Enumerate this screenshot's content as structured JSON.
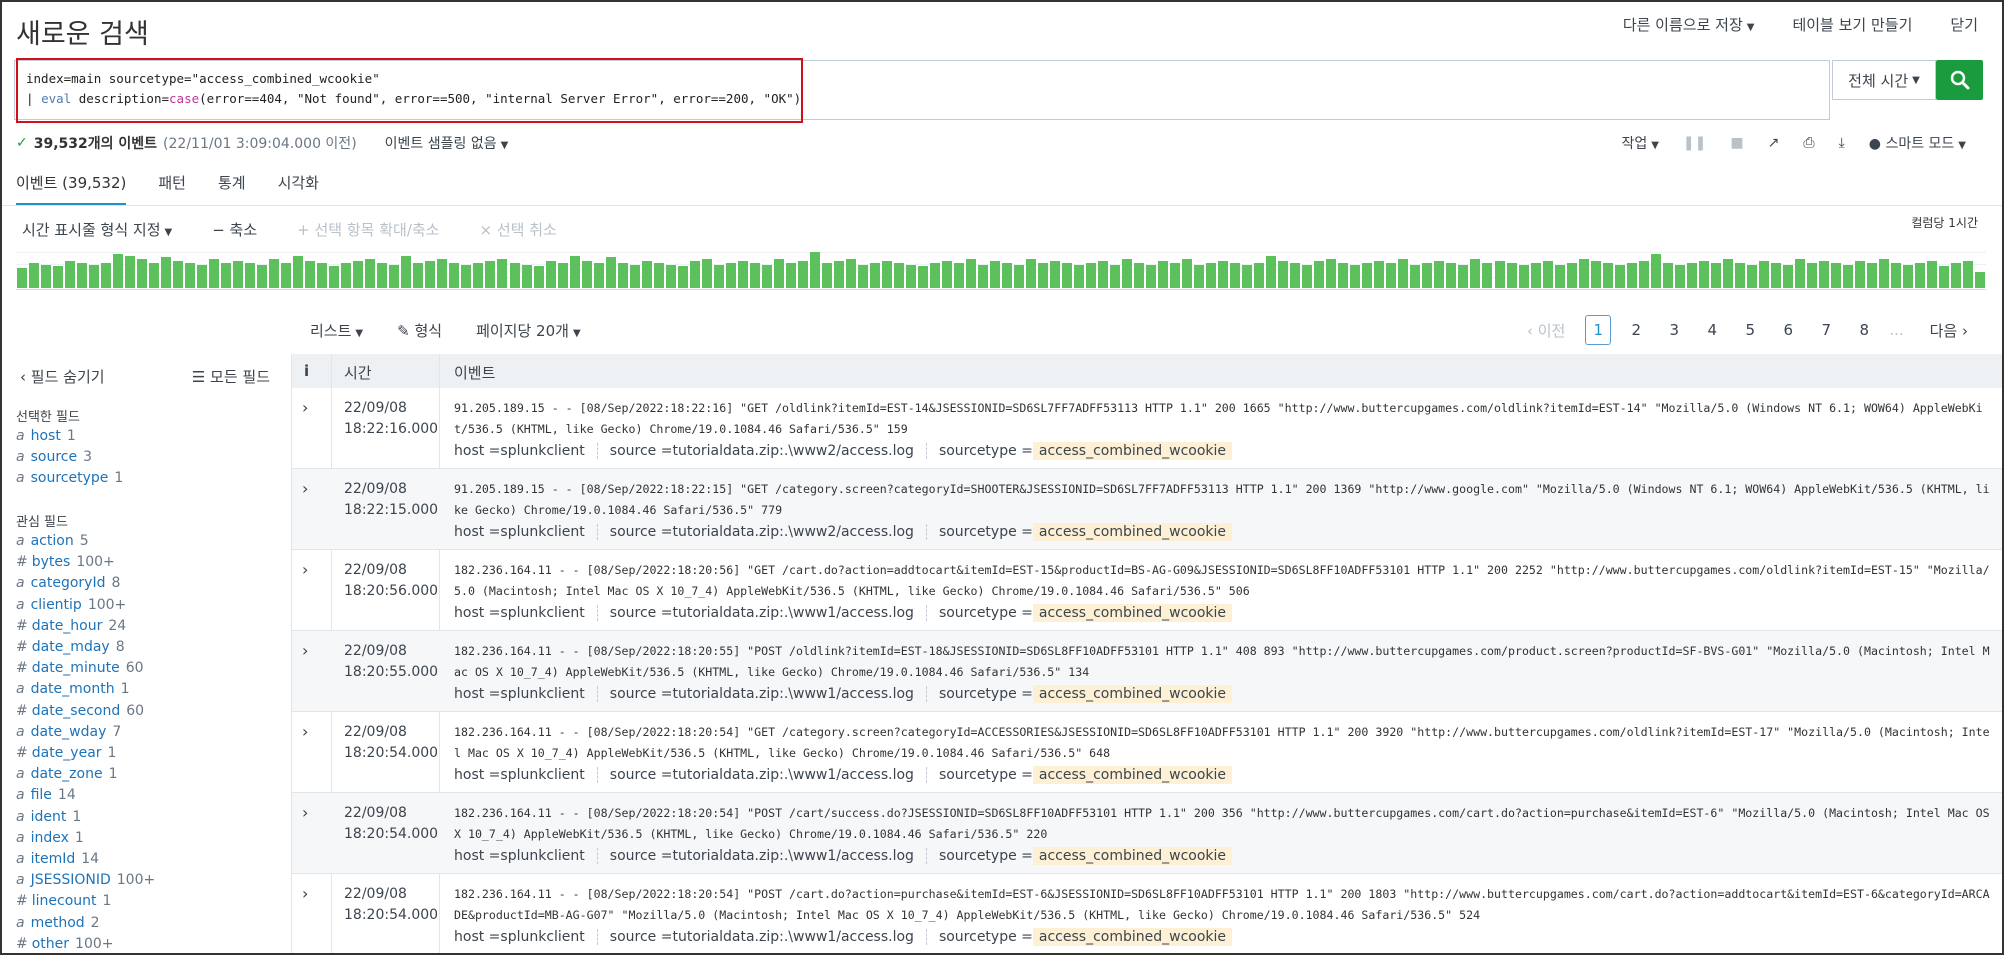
{
  "header": {
    "title": "새로운 검색",
    "save_as": "다른 이름으로 저장",
    "create_table_view": "테이블 보기 만들기",
    "close": "닫기"
  },
  "search": {
    "line1_a": "index=main sourcetype=",
    "line1_b": "\"access_combined_wcookie\"",
    "line2_pipe": "| ",
    "line2_cmd": "eval",
    "line2_mid": " description=",
    "line2_fn": "case",
    "line2_args": "(error==404, \"Not found\", error==500, \"internal Server Error\", error==200, \"OK\")",
    "time_range": "전체 시간"
  },
  "status": {
    "count": "39,532개의 이벤트",
    "before": "(22/11/01 3:09:04.000 이전)",
    "sampling": "이벤트 샘플링 없음",
    "job": "작업",
    "smart_mode": "스마트 모드"
  },
  "tabs": [
    {
      "label": "이벤트 (39,532)"
    },
    {
      "label": "패턴"
    },
    {
      "label": "통계"
    },
    {
      "label": "시각화"
    }
  ],
  "timeline": {
    "format": "시간 표시줄 형식 지정",
    "zoom_out": "− 축소",
    "zoom_selection": "+ 선택 항목 확대/축소",
    "deselect": "× 선택 취소",
    "scale": "컬럼당 1시간",
    "bars": [
      0.55,
      0.7,
      0.65,
      0.6,
      0.75,
      0.7,
      0.65,
      0.7,
      0.95,
      0.9,
      0.8,
      0.7,
      0.85,
      0.75,
      0.7,
      0.65,
      0.8,
      0.7,
      0.75,
      0.7,
      0.65,
      0.8,
      0.7,
      0.9,
      0.75,
      0.7,
      0.6,
      0.7,
      0.75,
      0.8,
      0.7,
      0.65,
      0.9,
      0.7,
      0.75,
      0.8,
      0.7,
      0.65,
      0.7,
      0.75,
      0.8,
      0.7,
      0.65,
      0.6,
      0.75,
      0.7,
      0.9,
      0.75,
      0.7,
      0.85,
      0.7,
      0.65,
      0.75,
      0.7,
      0.65,
      0.6,
      0.75,
      0.8,
      0.65,
      0.7,
      0.75,
      0.7,
      0.65,
      0.8,
      0.7,
      0.75,
      1.0,
      0.7,
      0.75,
      0.8,
      0.65,
      0.7,
      0.75,
      0.7,
      0.65,
      0.6,
      0.7,
      0.75,
      0.7,
      0.8,
      0.65,
      0.75,
      0.7,
      0.65,
      0.8,
      0.7,
      0.75,
      0.7,
      0.65,
      0.7,
      0.75,
      0.65,
      0.8,
      0.7,
      0.65,
      0.75,
      0.7,
      0.8,
      0.65,
      0.7,
      0.75,
      0.7,
      0.65,
      0.7,
      0.9,
      0.75,
      0.7,
      0.65,
      0.75,
      0.8,
      0.7,
      0.65,
      0.7,
      0.75,
      0.7,
      0.8,
      0.65,
      0.7,
      0.75,
      0.7,
      0.65,
      0.8,
      0.7,
      0.75,
      0.7,
      0.65,
      0.7,
      0.75,
      0.65,
      0.7,
      0.8,
      0.75,
      0.7,
      0.65,
      0.7,
      0.75,
      0.95,
      0.7,
      0.65,
      0.7,
      0.75,
      0.7,
      0.8,
      0.7,
      0.65,
      0.75,
      0.7,
      0.65,
      0.8,
      0.7,
      0.75,
      0.7,
      0.65,
      0.75,
      0.7,
      0.8,
      0.7,
      0.65,
      0.7,
      0.75,
      0.6,
      0.7,
      0.75,
      0.45
    ]
  },
  "list_controls": {
    "list": "리스트",
    "format": "형식",
    "per_page": "페이지당 20개"
  },
  "pager": {
    "prev": "‹ 이전",
    "pages": [
      "1",
      "2",
      "3",
      "4",
      "5",
      "6",
      "7",
      "8"
    ],
    "ellipsis": "...",
    "next": "다음 ›"
  },
  "sidebar": {
    "hide_fields": "필드 숨기기",
    "all_fields": "모든 필드",
    "selected_title": "선택한 필드",
    "interesting_title": "관심 필드",
    "selected": [
      {
        "type": "a",
        "name": "host",
        "count": "1"
      },
      {
        "type": "a",
        "name": "source",
        "count": "3"
      },
      {
        "type": "a",
        "name": "sourcetype",
        "count": "1"
      }
    ],
    "interesting": [
      {
        "type": "a",
        "name": "action",
        "count": "5"
      },
      {
        "type": "#",
        "name": "bytes",
        "count": "100+"
      },
      {
        "type": "a",
        "name": "categoryId",
        "count": "8"
      },
      {
        "type": "a",
        "name": "clientip",
        "count": "100+"
      },
      {
        "type": "#",
        "name": "date_hour",
        "count": "24"
      },
      {
        "type": "#",
        "name": "date_mday",
        "count": "8"
      },
      {
        "type": "#",
        "name": "date_minute",
        "count": "60"
      },
      {
        "type": "a",
        "name": "date_month",
        "count": "1"
      },
      {
        "type": "#",
        "name": "date_second",
        "count": "60"
      },
      {
        "type": "a",
        "name": "date_wday",
        "count": "7"
      },
      {
        "type": "#",
        "name": "date_year",
        "count": "1"
      },
      {
        "type": "a",
        "name": "date_zone",
        "count": "1"
      },
      {
        "type": "a",
        "name": "file",
        "count": "14"
      },
      {
        "type": "a",
        "name": "ident",
        "count": "1"
      },
      {
        "type": "a",
        "name": "index",
        "count": "1"
      },
      {
        "type": "a",
        "name": "itemId",
        "count": "14"
      },
      {
        "type": "a",
        "name": "JSESSIONID",
        "count": "100+"
      },
      {
        "type": "#",
        "name": "linecount",
        "count": "1"
      },
      {
        "type": "a",
        "name": "method",
        "count": "2"
      },
      {
        "type": "#",
        "name": "other",
        "count": "100+"
      }
    ]
  },
  "table": {
    "col_info": "i",
    "col_time": "시간",
    "col_event": "이벤트",
    "host_label": "host = ",
    "source_label": "source = ",
    "sourcetype_label": "sourcetype = ",
    "events": [
      {
        "date": "22/09/08",
        "time": "18:22:16.000",
        "raw": "91.205.189.15 - - [08/Sep/2022:18:22:16] \"GET /oldlink?itemId=EST-14&JSESSIONID=SD6SL7FF7ADFF53113 HTTP 1.1\" 200 1665 \"http://www.buttercupgames.com/oldlink?itemId=EST-14\" \"Mozilla/5.0 (Windows NT 6.1; WOW64) AppleWebKit/536.5 (KHTML, like Gecko) Chrome/19.0.1084.46 Safari/536.5\" 159",
        "host": "splunkclient",
        "source": "tutorialdata.zip:.\\www2/access.log",
        "sourcetype": "access_combined_wcookie"
      },
      {
        "date": "22/09/08",
        "time": "18:22:15.000",
        "raw": "91.205.189.15 - - [08/Sep/2022:18:22:15] \"GET /category.screen?categoryId=SHOOTER&JSESSIONID=SD6SL7FF7ADFF53113 HTTP 1.1\" 200 1369 \"http://www.google.com\" \"Mozilla/5.0 (Windows NT 6.1; WOW64) AppleWebKit/536.5 (KHTML, like Gecko) Chrome/19.0.1084.46 Safari/536.5\" 779",
        "host": "splunkclient",
        "source": "tutorialdata.zip:.\\www2/access.log",
        "sourcetype": "access_combined_wcookie"
      },
      {
        "date": "22/09/08",
        "time": "18:20:56.000",
        "raw": "182.236.164.11 - - [08/Sep/2022:18:20:56] \"GET /cart.do?action=addtocart&itemId=EST-15&productId=BS-AG-G09&JSESSIONID=SD6SL8FF10ADFF53101 HTTP 1.1\" 200 2252 \"http://www.buttercupgames.com/oldlink?itemId=EST-15\" \"Mozilla/5.0 (Macintosh; Intel Mac OS X 10_7_4) AppleWebKit/536.5 (KHTML, like Gecko) Chrome/19.0.1084.46 Safari/536.5\" 506",
        "host": "splunkclient",
        "source": "tutorialdata.zip:.\\www1/access.log",
        "sourcetype": "access_combined_wcookie"
      },
      {
        "date": "22/09/08",
        "time": "18:20:55.000",
        "raw": "182.236.164.11 - - [08/Sep/2022:18:20:55] \"POST /oldlink?itemId=EST-18&JSESSIONID=SD6SL8FF10ADFF53101 HTTP 1.1\" 408 893 \"http://www.buttercupgames.com/product.screen?productId=SF-BVS-G01\" \"Mozilla/5.0 (Macintosh; Intel Mac OS X 10_7_4) AppleWebKit/536.5 (KHTML, like Gecko) Chrome/19.0.1084.46 Safari/536.5\" 134",
        "host": "splunkclient",
        "source": "tutorialdata.zip:.\\www1/access.log",
        "sourcetype": "access_combined_wcookie"
      },
      {
        "date": "22/09/08",
        "time": "18:20:54.000",
        "raw": "182.236.164.11 - - [08/Sep/2022:18:20:54] \"GET /category.screen?categoryId=ACCESSORIES&JSESSIONID=SD6SL8FF10ADFF53101 HTTP 1.1\" 200 3920 \"http://www.buttercupgames.com/oldlink?itemId=EST-17\" \"Mozilla/5.0 (Macintosh; Intel Mac OS X 10_7_4) AppleWebKit/536.5 (KHTML, like Gecko) Chrome/19.0.1084.46 Safari/536.5\" 648",
        "host": "splunkclient",
        "source": "tutorialdata.zip:.\\www1/access.log",
        "sourcetype": "access_combined_wcookie"
      },
      {
        "date": "22/09/08",
        "time": "18:20:54.000",
        "raw": "182.236.164.11 - - [08/Sep/2022:18:20:54] \"POST /cart/success.do?JSESSIONID=SD6SL8FF10ADFF53101 HTTP 1.1\" 200 356 \"http://www.buttercupgames.com/cart.do?action=purchase&itemId=EST-6\" \"Mozilla/5.0 (Macintosh; Intel Mac OS X 10_7_4) AppleWebKit/536.5 (KHTML, like Gecko) Chrome/19.0.1084.46 Safari/536.5\" 220",
        "host": "splunkclient",
        "source": "tutorialdata.zip:.\\www1/access.log",
        "sourcetype": "access_combined_wcookie"
      },
      {
        "date": "22/09/08",
        "time": "18:20:54.000",
        "raw": "182.236.164.11 - - [08/Sep/2022:18:20:54] \"POST /cart.do?action=purchase&itemId=EST-6&JSESSIONID=SD6SL8FF10ADFF53101 HTTP 1.1\" 200 1803 \"http://www.buttercupgames.com/cart.do?action=addtocart&itemId=EST-6&categoryId=ARCADE&productId=MB-AG-G07\" \"Mozilla/5.0 (Macintosh; Intel Mac OS X 10_7_4) AppleWebKit/536.5 (KHTML, like Gecko) Chrome/19.0.1084.46 Safari/536.5\" 524",
        "host": "splunkclient",
        "source": "tutorialdata.zip:.\\www1/access.log",
        "sourcetype": "access_combined_wcookie"
      }
    ]
  },
  "colors": {
    "accent": "#1e93c6",
    "search_button": "#1a9c3e",
    "timeline_bar": "#5cc05c",
    "highlight_border": "#d0101a",
    "sourcetype_bg": "#fdf0d5"
  }
}
